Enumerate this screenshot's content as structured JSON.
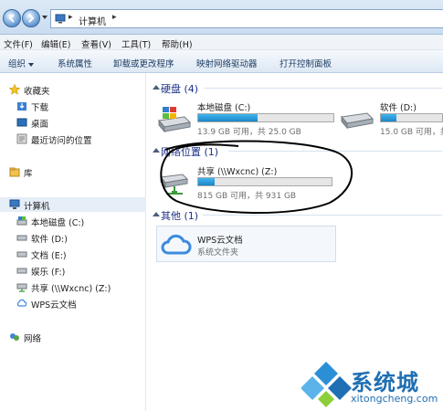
{
  "address": {
    "segment": "计算机"
  },
  "menu": [
    "文件(F)",
    "编辑(E)",
    "查看(V)",
    "工具(T)",
    "帮助(H)"
  ],
  "toolbar": [
    "组织",
    "系统属性",
    "卸载或更改程序",
    "映射网络驱动器",
    "打开控制面板"
  ],
  "sidebar": {
    "favorites": "收藏夹",
    "downloads": "下载",
    "desktop": "桌面",
    "recent": "最近访问的位置",
    "libraries": "库",
    "computer": "计算机",
    "drive_c": "本地磁盘 (C:)",
    "drive_d": "软件 (D:)",
    "drive_e": "文档 (E:)",
    "drive_f": "娱乐 (F:)",
    "drive_z": "共享 (\\\\Wxcnc) (Z:)",
    "wps": "WPS云文档",
    "network": "网络"
  },
  "groups": {
    "hdd": "硬盘 (4)",
    "netloc": "网络位置 (1)",
    "other": "其他 (1)"
  },
  "drives": {
    "c": {
      "name": "本地磁盘 (C:)",
      "free": "13.9 GB 可用，共 25.0 GB",
      "used_fraction": 0.44
    },
    "d": {
      "name": "软件 (D:)",
      "free": "15.0 GB 可用，共",
      "used_fraction": 0.25
    },
    "z": {
      "name": "共享 (\\\\Wxcnc) (Z:)",
      "free": "815 GB 可用，共 931 GB",
      "used_fraction": 0.12
    }
  },
  "wps": {
    "name": "WPS云文档",
    "type": "系统文件夹"
  },
  "watermark": {
    "brand": "系统城",
    "url": "xitongcheng.com"
  },
  "colors": {
    "accent": "#1f6fb4",
    "bar": "#26a0e0"
  }
}
